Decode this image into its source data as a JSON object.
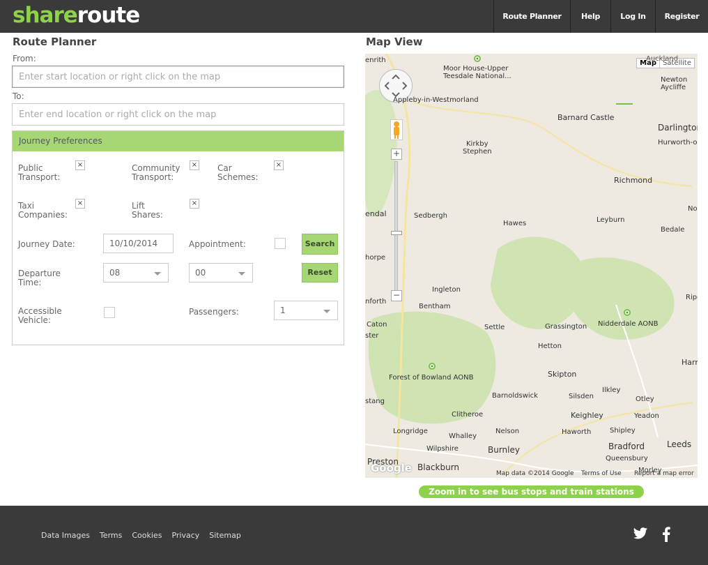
{
  "brand": {
    "part1": "share",
    "part2": "route"
  },
  "nav": [
    {
      "label": "Route Planner"
    },
    {
      "label": "Help"
    },
    {
      "label": "Log In"
    },
    {
      "label": "Register"
    }
  ],
  "planner": {
    "title": "Route Planner",
    "from_label": "From:",
    "from_placeholder": "Enter start location or right click on the map",
    "to_label": "To:",
    "to_placeholder": "Enter end location or right click on the map"
  },
  "prefs": {
    "title": "Journey Preferences",
    "options": [
      {
        "label_line1": "Public",
        "label_line2": "Transport:",
        "checked": true,
        "mark": "×"
      },
      {
        "label_line1": "Community",
        "label_line2": "Transport:",
        "checked": true,
        "mark": "×"
      },
      {
        "label_line1": "Car",
        "label_line2": "Schemes:",
        "checked": true,
        "mark": "×"
      },
      {
        "label_line1": "Taxi",
        "label_line2": "Companies:",
        "checked": true,
        "mark": "×"
      },
      {
        "label_line1": "Lift",
        "label_line2": "Shares:",
        "checked": true,
        "mark": "×"
      }
    ],
    "journey_date_label": "Journey Date:",
    "journey_date_value": "10/10/2014",
    "appointment_label": "Appointment:",
    "search_label": "Search",
    "departure_label_line1": "Departure",
    "departure_label_line2": "Time:",
    "departure_hour": "08",
    "departure_minute": "00",
    "reset_label": "Reset",
    "accessible_label_line1": "Accessible",
    "accessible_label_line2": "Vehicle:",
    "passengers_label": "Passengers:",
    "passengers_value": "1"
  },
  "map": {
    "title": "Map View",
    "type_map": "Map",
    "type_satellite": "Satellite",
    "places": [
      "Moor House-Upper",
      "Teesdale National...",
      "Appleby-in-Westmorland",
      "Kirkby",
      "Stephen",
      "Barnard Castle",
      "Darlington",
      "Hurworth-on",
      "Newton",
      "Aycliffe",
      "Auckland",
      "Richmond",
      "Leyburn",
      "Bedale",
      "Hawes",
      "Sedbergh",
      "endal",
      "horpe",
      "Ingleton",
      "Bentham",
      "nforth",
      "Caton",
      "ster",
      "Settle",
      "Grassington",
      "Nidderdale AONB",
      "Ripon",
      "Hetton",
      "Harrogate",
      "Forest of Bowland AONB",
      "Skipton",
      "Barnoldswick",
      "Silsden",
      "Ilkley",
      "Otley",
      "stang",
      "Clitheroe",
      "Keighley",
      "Yeadon",
      "Longridge",
      "Whalley",
      "Nelson",
      "Haworth",
      "Shipley",
      "Wilpshire",
      "Burnley",
      "Bradford",
      "Leeds",
      "Queensbury",
      "Preston",
      "Blackburn",
      "Morley",
      "enrith",
      "No"
    ],
    "attribution": [
      "Map data ©2014 Google",
      "Terms of Use",
      "Report a map error"
    ],
    "google_logo": "Google",
    "zoom_notice": "Zoom in to see bus stops and train stations"
  },
  "footer": {
    "links": [
      "Data Images",
      "Terms",
      "Cookies",
      "Privacy",
      "Sitemap"
    ]
  },
  "colors": {
    "brand_green": "#8ed14a",
    "header_bg": "#3a3a3a",
    "prefs_green": "#a6d774"
  }
}
